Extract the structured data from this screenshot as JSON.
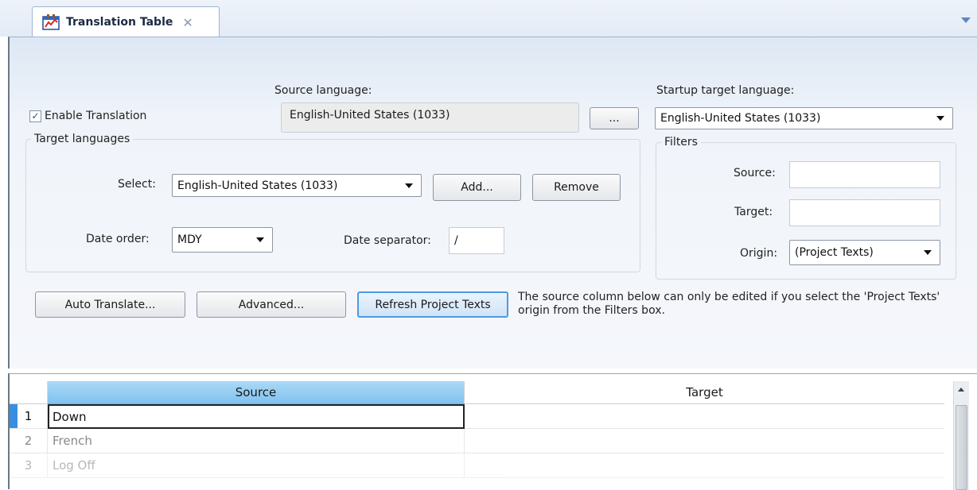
{
  "tab": {
    "title": "Translation Table",
    "close": "✕",
    "icon": "translation-table-icon"
  },
  "options": {
    "enable_translation_label": "Enable Translation",
    "enable_translation_checked": true,
    "check_mark": "✓",
    "source_language_label": "Source language:",
    "source_language_value": "English-United States (1033)",
    "browse_label": "...",
    "startup_target_label": "Startup target language:",
    "startup_target_value": "English-United States (1033)"
  },
  "target_languages": {
    "legend": "Target languages",
    "select_label": "Select:",
    "select_value": "English-United States (1033)",
    "add_label": "Add...",
    "remove_label": "Remove",
    "date_order_label": "Date order:",
    "date_order_value": "MDY",
    "date_separator_label": "Date separator:",
    "date_separator_value": "/"
  },
  "filters": {
    "legend": "Filters",
    "source_label": "Source:",
    "source_value": "",
    "target_label": "Target:",
    "target_value": "",
    "origin_label": "Origin:",
    "origin_value": "(Project Texts)"
  },
  "actions": {
    "auto_translate": "Auto Translate...",
    "advanced": "Advanced...",
    "refresh": "Refresh Project Texts",
    "hint": "The source column below can only be edited if you select the 'Project Texts' origin from the Filters box."
  },
  "grid": {
    "columns": [
      "Source",
      "Target"
    ],
    "rows": [
      {
        "num": "1",
        "source": "Down",
        "target": ""
      },
      {
        "num": "2",
        "source": "French",
        "target": ""
      },
      {
        "num": "3",
        "source": "Log Off",
        "target": ""
      }
    ]
  },
  "colors": {
    "accent": "#4d9ae0",
    "header_selected": "#9ccff3",
    "row_indicator": "#3a8ee0"
  }
}
